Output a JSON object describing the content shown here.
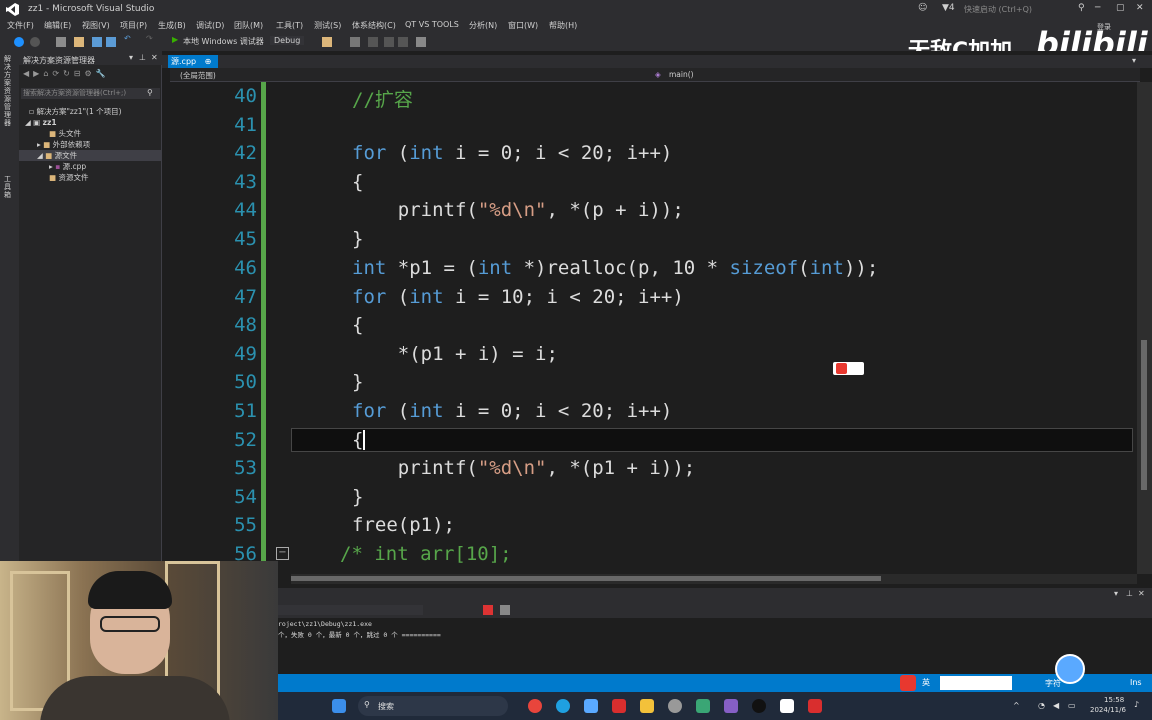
{
  "titlebar": {
    "title": "zz1 - Microsoft Visual Studio",
    "search_placeholder": "快速启动 (Ctrl+Q)",
    "notify_count": "4"
  },
  "menu": [
    "文件(F)",
    "编辑(E)",
    "视图(V)",
    "项目(P)",
    "生成(B)",
    "调试(D)",
    "团队(M)",
    "工具(T)",
    "测试(S)",
    "体系结构(C)",
    "QT VS TOOLS",
    "分析(N)",
    "窗口(W)",
    "帮助(H)"
  ],
  "toolbar": {
    "run_label": "本地 Windows 调试器",
    "config": "Debug"
  },
  "watermark": {
    "text": "无敌C加加",
    "brand": "bilibili",
    "login": "登录"
  },
  "solution_explorer": {
    "title": "解决方案资源管理器",
    "search_placeholder": "搜索解决方案资源管理器(Ctrl+;)",
    "items": [
      {
        "label": "解决方案\"zz1\"(1 个项目)"
      },
      {
        "label": "zz1"
      },
      {
        "label": "头文件"
      },
      {
        "label": "外部依赖项"
      },
      {
        "label": "源文件"
      },
      {
        "label": "源.cpp"
      },
      {
        "label": "资源文件"
      }
    ]
  },
  "side_tabs": [
    "解决方案资源管理器",
    "工具箱"
  ],
  "editor": {
    "tab": "源.cpp",
    "scope": "(全局范围)",
    "function": "main()",
    "lines": [
      {
        "n": "40",
        "code": "//扩容"
      },
      {
        "n": "41",
        "code": ""
      },
      {
        "n": "42",
        "code": "for (int i = 0; i < 20; i++)"
      },
      {
        "n": "43",
        "code": "{"
      },
      {
        "n": "44",
        "code": "    printf(\"%d\\n\", *(p + i));"
      },
      {
        "n": "45",
        "code": "}"
      },
      {
        "n": "46",
        "code": "int *p1 = (int *)realloc(p, 10 * sizeof(int));"
      },
      {
        "n": "47",
        "code": "for (int i = 10; i < 20; i++)"
      },
      {
        "n": "48",
        "code": "{"
      },
      {
        "n": "49",
        "code": "    *(p1 + i) = i;"
      },
      {
        "n": "50",
        "code": "}"
      },
      {
        "n": "51",
        "code": "for (int i = 0; i < 20; i++)"
      },
      {
        "n": "52",
        "code": "{"
      },
      {
        "n": "53",
        "code": "    printf(\"%d\\n\", *(p1 + i));"
      },
      {
        "n": "54",
        "code": "}"
      },
      {
        "n": "55",
        "code": "free(p1);"
      },
      {
        "n": "56",
        "code": "/* int arr[10];"
      }
    ]
  },
  "output": {
    "line1": "roject\\zz1\\Debug\\zz1.exe",
    "line2": "个，失败 0 个，最新 0 个，跳过 0 个 =========="
  },
  "statusbar": {
    "char": "字符",
    "mode": "Ins",
    "ime": "英"
  },
  "taskbar": {
    "search": "搜索",
    "time": "15:58",
    "date": "2024/11/6"
  },
  "colors": {
    "accent": "#007acc",
    "keyword": "#569cd6",
    "string": "#d69d85",
    "comment": "#57a64a",
    "line_number": "#2b91af"
  }
}
